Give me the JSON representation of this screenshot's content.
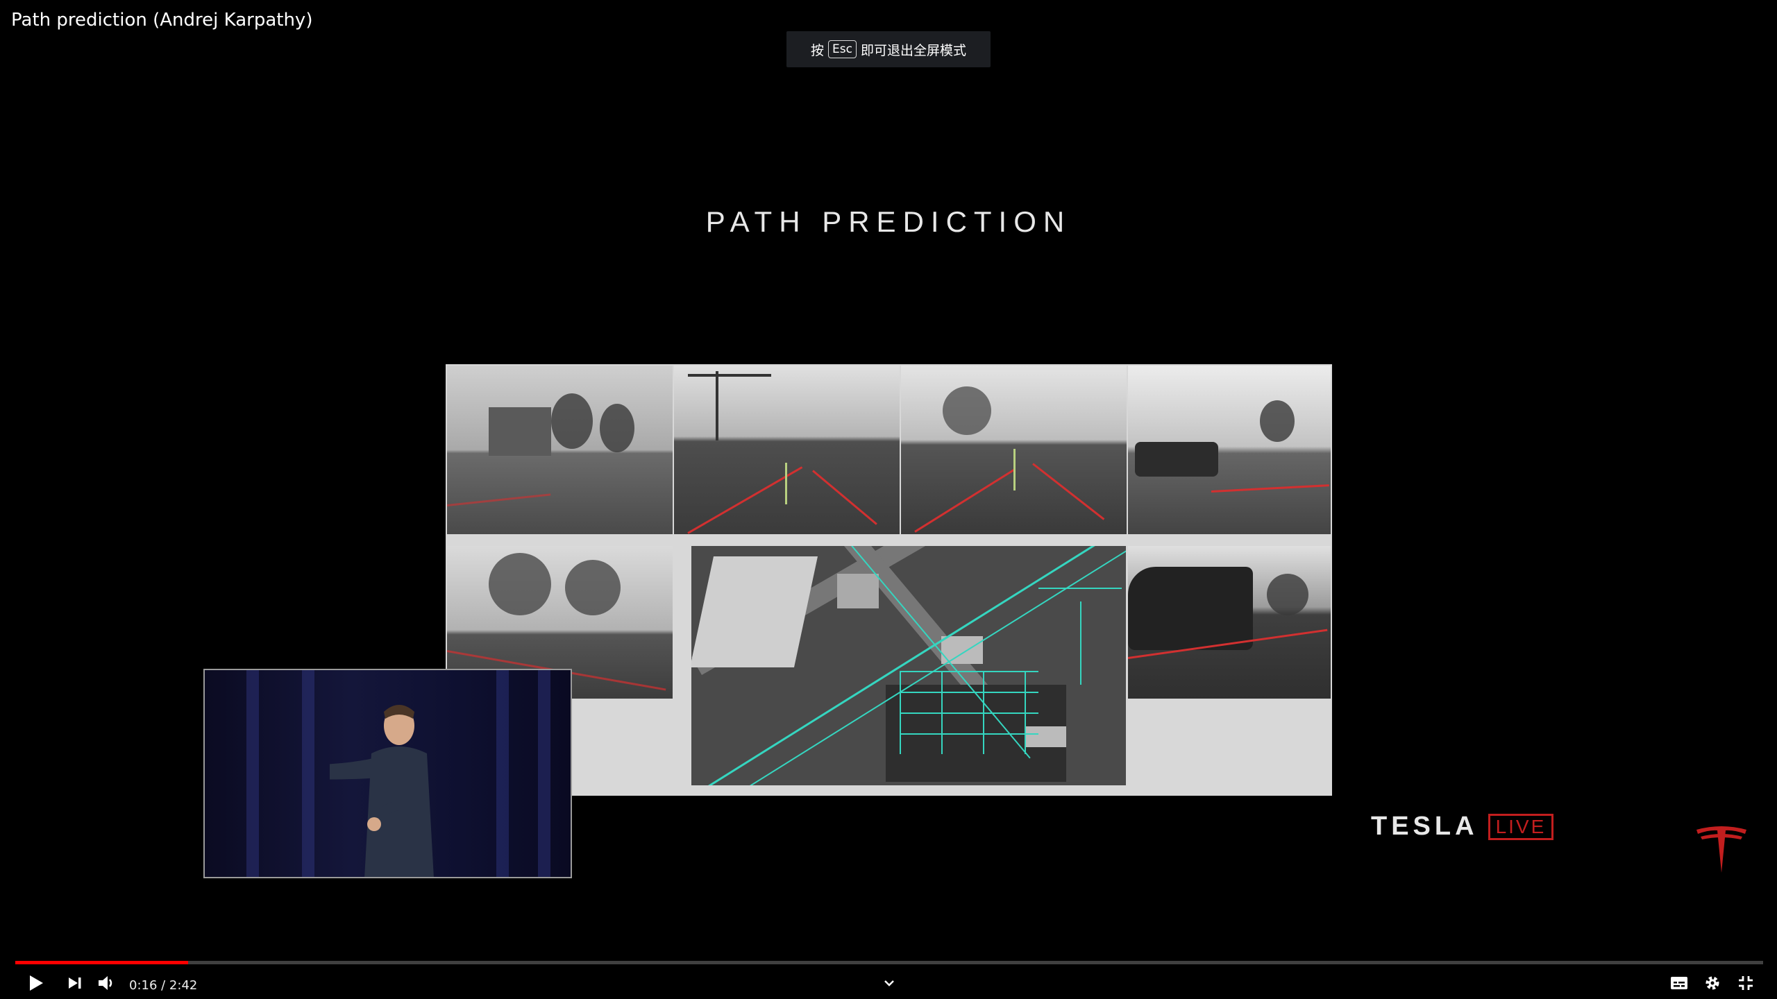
{
  "video": {
    "title": "Path prediction (Andrej Karpathy)",
    "current_time": "0:16",
    "duration": "2:42",
    "time_display": "0:16 / 2:42",
    "progress_fraction": 0.099
  },
  "esc_toast": {
    "prefix": "按",
    "key": "Esc",
    "suffix": "即可退出全屏模式"
  },
  "slide": {
    "title": "PATH PREDICTION"
  },
  "branding": {
    "tesla_wordmark": "TESLA",
    "live_badge": "LIVE",
    "accent_color": "#c21e1e"
  },
  "controls": {
    "play_icon": "play-icon",
    "next_icon": "next-icon",
    "volume_icon": "volume-icon",
    "chapter_icon": "chevron-down-icon",
    "subtitles_icon": "subtitles-icon",
    "settings_icon": "gear-icon",
    "exit_fullscreen_icon": "exit-fullscreen-icon"
  },
  "colors": {
    "progress": "#ff0000",
    "map_paths": "#35d6c0"
  }
}
